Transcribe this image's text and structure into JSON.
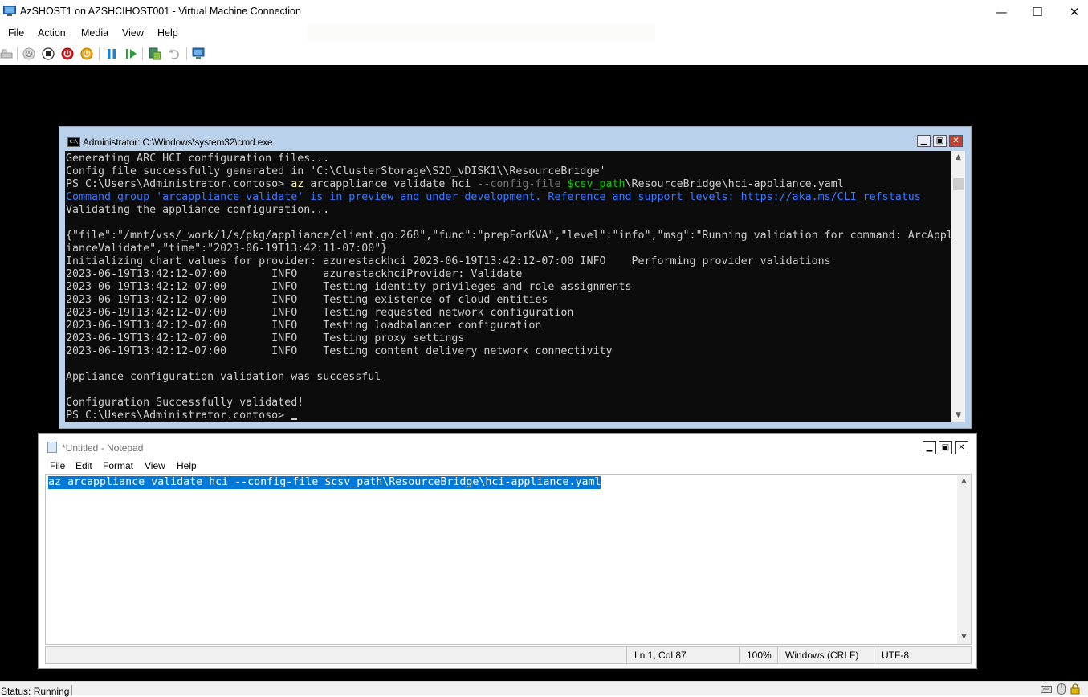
{
  "vm": {
    "title": "AzSHOST1 on AZSHCIHOST001 - Virtual Machine Connection",
    "controls": {
      "minimize": "—",
      "maximize": "☐",
      "close": "✕"
    },
    "menu": [
      "File",
      "Action",
      "Media",
      "View",
      "Help"
    ],
    "toolbar_icons": [
      "ctrl-alt-del-icon",
      "start-icon",
      "turn-off-icon",
      "shut-down-icon",
      "power-icon",
      "pause-icon",
      "resume-icon",
      "checkpoint-icon",
      "revert-icon",
      "enhanced-session-icon"
    ],
    "status": "Status: Running"
  },
  "cmd": {
    "title": "Administrator: C:\\Windows\\system32\\cmd.exe",
    "icon_label": "C:\\",
    "lines": [
      "Generating ARC HCI configuration files...",
      "Config file successfully generated in 'C:\\ClusterStorage\\S2D_vDISK1\\\\ResourceBridge'",
      {
        "segments": [
          {
            "text": "PS C:\\Users\\Administrator.contoso> ",
            "style": "plain"
          },
          {
            "text": "az",
            "style": "yellow"
          },
          {
            "text": " arcappliance validate hci ",
            "style": "plain"
          },
          {
            "text": "--config-file",
            "style": "grey"
          },
          {
            "text": " ",
            "style": "plain"
          },
          {
            "text": "$csv_path",
            "style": "green"
          },
          {
            "text": "\\ResourceBridge\\hci-appliance.yaml",
            "style": "plain"
          }
        ]
      },
      {
        "segments": [
          {
            "text": "Command group 'arcappliance validate' is in preview and under development. Reference and support levels: https://aka.ms/CLI_refstatus",
            "style": "blue"
          }
        ]
      },
      "Validating the appliance configuration...",
      "",
      "{\"file\":\"/mnt/vss/_work/1/s/pkg/appliance/client.go:268\",\"func\":\"prepForKVA\",\"level\":\"info\",\"msg\":\"Running validation for command: ArcAppl",
      "ianceValidate\",\"time\":\"2023-06-19T13:42:11-07:00\"}",
      "Initializing chart values for provider: azurestackhci 2023-06-19T13:42:12-07:00 INFO    Performing provider validations",
      "2023-06-19T13:42:12-07:00       INFO    azurestackhciProvider: Validate",
      "2023-06-19T13:42:12-07:00       INFO    Testing identity privileges and role assignments",
      "2023-06-19T13:42:12-07:00       INFO    Testing existence of cloud entities",
      "2023-06-19T13:42:12-07:00       INFO    Testing requested network configuration",
      "2023-06-19T13:42:12-07:00       INFO    Testing loadbalancer configuration",
      "2023-06-19T13:42:12-07:00       INFO    Testing proxy settings",
      "2023-06-19T13:42:12-07:00       INFO    Testing content delivery network connectivity",
      "",
      "Appliance configuration validation was successful",
      "",
      "Configuration Successfully validated!",
      {
        "segments": [
          {
            "text": "PS C:\\Users\\Administrator.contoso> ",
            "style": "plain"
          }
        ],
        "cursor": true
      }
    ]
  },
  "notepad": {
    "title": "*Untitled - Notepad",
    "menu": [
      "File",
      "Edit",
      "Format",
      "View",
      "Help"
    ],
    "text": "az arcappliance validate hci --config-file $csv_path\\ResourceBridge\\hci-appliance.yaml",
    "status": {
      "position": "Ln 1, Col 87",
      "zoom": "100%",
      "line_ending": "Windows (CRLF)",
      "encoding": "UTF-8"
    }
  },
  "colors": {
    "console_bg": "#0c0c0c",
    "console_fg": "#cccccc",
    "selection": "#0078d7",
    "cmd_frame": "#b9d1ea"
  }
}
